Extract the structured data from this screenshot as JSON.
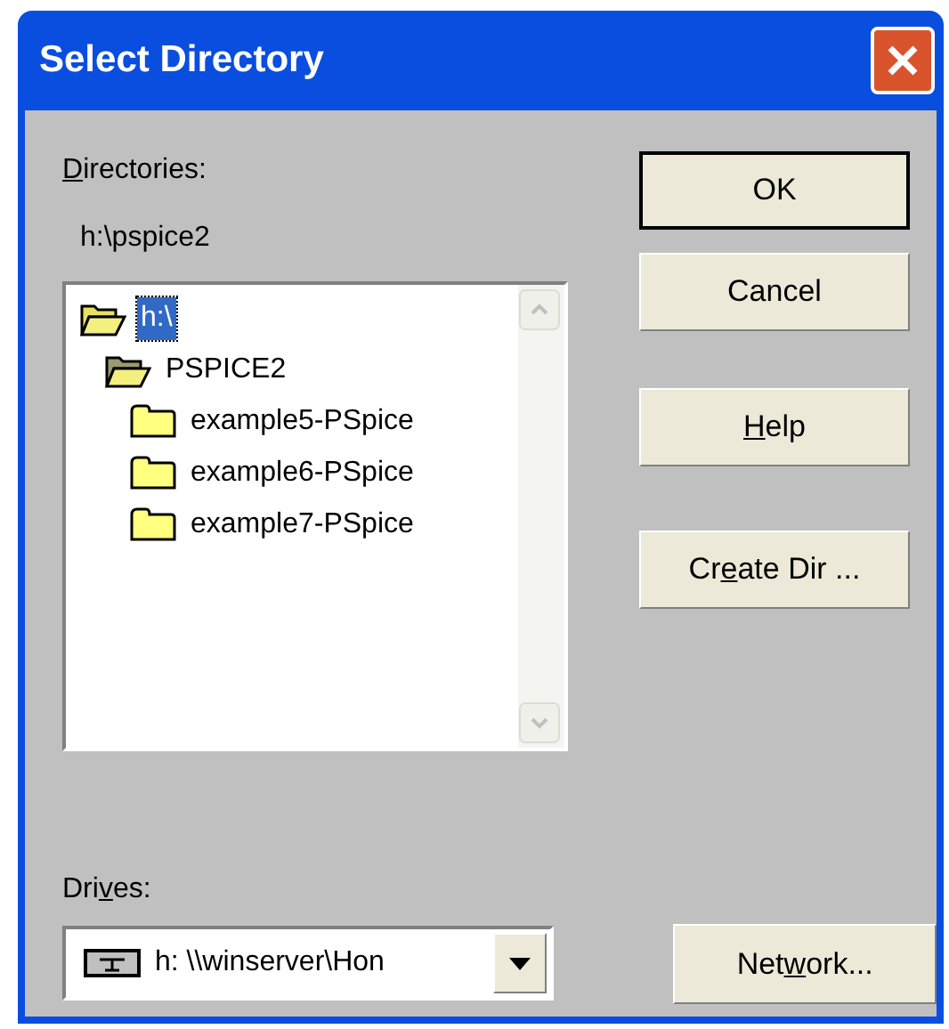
{
  "window": {
    "title": "Select Directory"
  },
  "directories": {
    "label": {
      "key": "D",
      "post": "irectories:"
    },
    "current_path": "h:\\pspice2",
    "tree": [
      {
        "label": "h:\\",
        "kind": "open",
        "selected": true,
        "children": [
          {
            "label": "PSPICE2",
            "kind": "open",
            "selected": false,
            "children": [
              {
                "label": "example5-PSpice",
                "kind": "closed",
                "selected": false
              },
              {
                "label": "example6-PSpice",
                "kind": "closed",
                "selected": false
              },
              {
                "label": "example7-PSpice",
                "kind": "closed",
                "selected": false
              }
            ]
          }
        ]
      }
    ]
  },
  "drives": {
    "label": {
      "pre": "Dri",
      "key": "v",
      "post": "es:"
    },
    "value": "h: \\\\winserver\\Hon"
  },
  "buttons": [
    {
      "label": {
        "post": "OK"
      },
      "default": true
    },
    {
      "label": {
        "post": "Cancel"
      },
      "default": false
    },
    {
      "label": {
        "key": "H",
        "post": "elp"
      },
      "default": false
    },
    {
      "label": {
        "pre": "Cr",
        "key": "e",
        "post": "ate Dir ..."
      },
      "default": false
    }
  ],
  "network_button": {
    "label": {
      "pre": "Net",
      "key": "w",
      "post": "ork..."
    }
  }
}
